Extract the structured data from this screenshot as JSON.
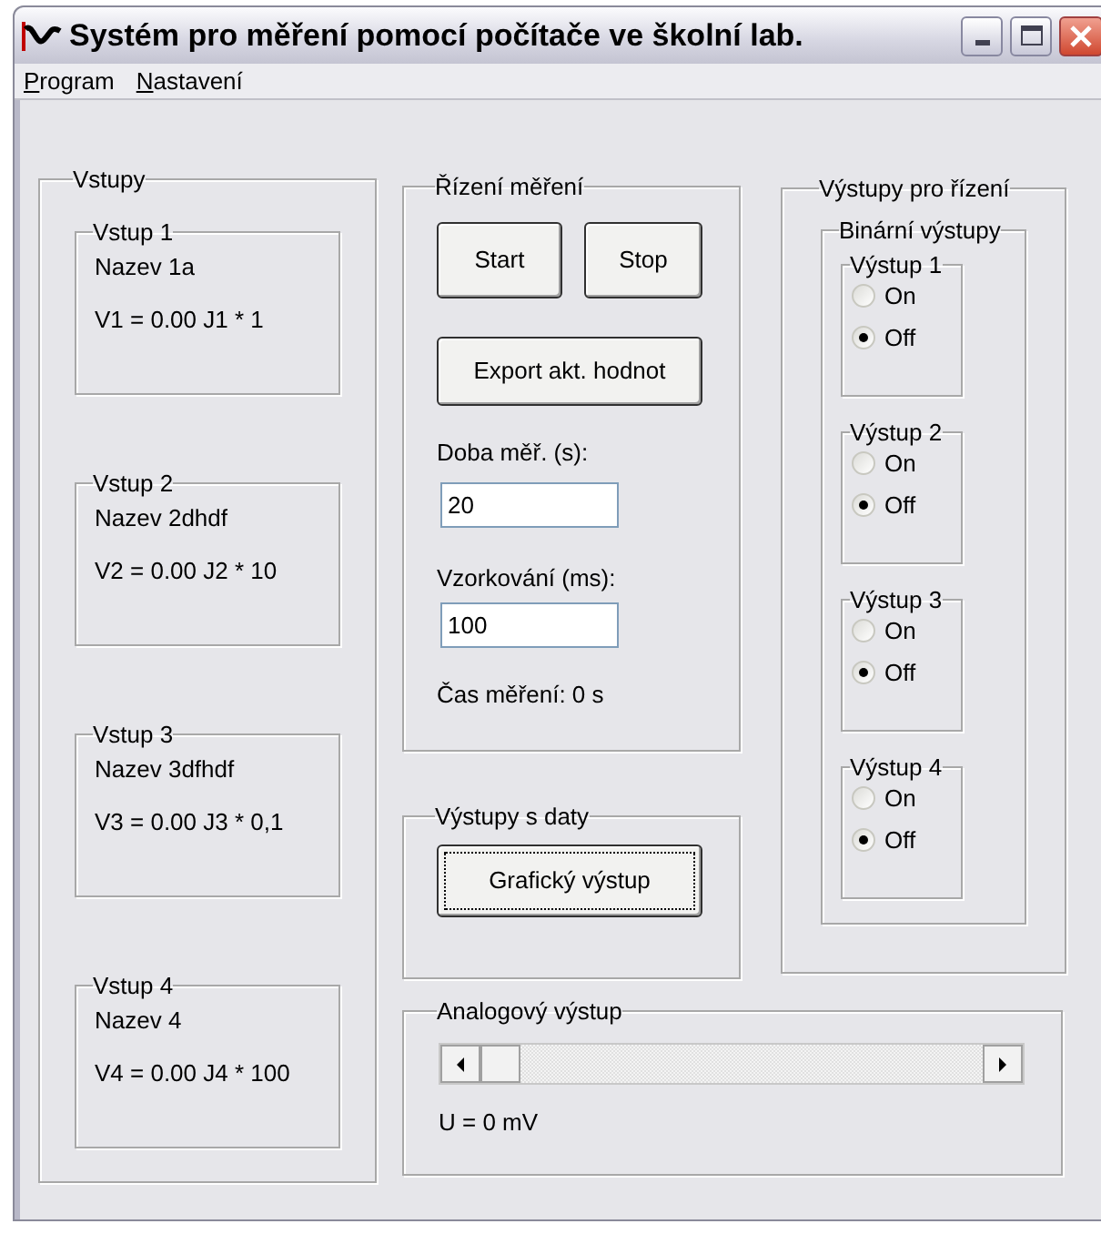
{
  "window": {
    "title": "Systém pro měření pomocí počítače ve školní lab."
  },
  "menu": [
    {
      "label": "Program"
    },
    {
      "label": "Nastavení"
    }
  ],
  "inputs": {
    "title": "Vstupy",
    "items": [
      {
        "title": "Vstup 1",
        "name": "Nazev 1a",
        "formula": "V1 = 0.00 J1 * 1"
      },
      {
        "title": "Vstup 2",
        "name": "Nazev 2dhdf",
        "formula": "V2 = 0.00 J2 * 10"
      },
      {
        "title": "Vstup 3",
        "name": "Nazev 3dfhdf",
        "formula": "V3 = 0.00 J3 * 0,1"
      },
      {
        "title": "Vstup 4",
        "name": "Nazev 4",
        "formula": "V4 = 0.00 J4 * 100"
      }
    ]
  },
  "control": {
    "title": "Řízení měření",
    "start": "Start",
    "stop": "Stop",
    "export": "Export akt. hodnot",
    "duration": {
      "label": "Doba měř. (s):",
      "value": "20"
    },
    "sampling": {
      "label": "Vzorkování (ms):",
      "value": "100"
    },
    "elapsed": "Čas měření: 0 s"
  },
  "data_outputs": {
    "title": "Výstupy s daty",
    "button": "Grafický výstup"
  },
  "control_outputs": {
    "title": "Výstupy pro řízení",
    "binary_title": "Binární výstupy",
    "items": [
      {
        "title": "Výstup 1",
        "options": [
          {
            "label": "On",
            "selected": false
          },
          {
            "label": "Off",
            "selected": true
          }
        ]
      },
      {
        "title": "Výstup 2",
        "options": [
          {
            "label": "On",
            "selected": false
          },
          {
            "label": "Off",
            "selected": true
          }
        ]
      },
      {
        "title": "Výstup 3",
        "options": [
          {
            "label": "On",
            "selected": false
          },
          {
            "label": "Off",
            "selected": true
          }
        ]
      },
      {
        "title": "Výstup 4",
        "options": [
          {
            "label": "On",
            "selected": false
          },
          {
            "label": "Off",
            "selected": true
          }
        ]
      }
    ]
  },
  "analog": {
    "title": "Analogový výstup",
    "level": 0,
    "reading": "U = 0 mV"
  }
}
